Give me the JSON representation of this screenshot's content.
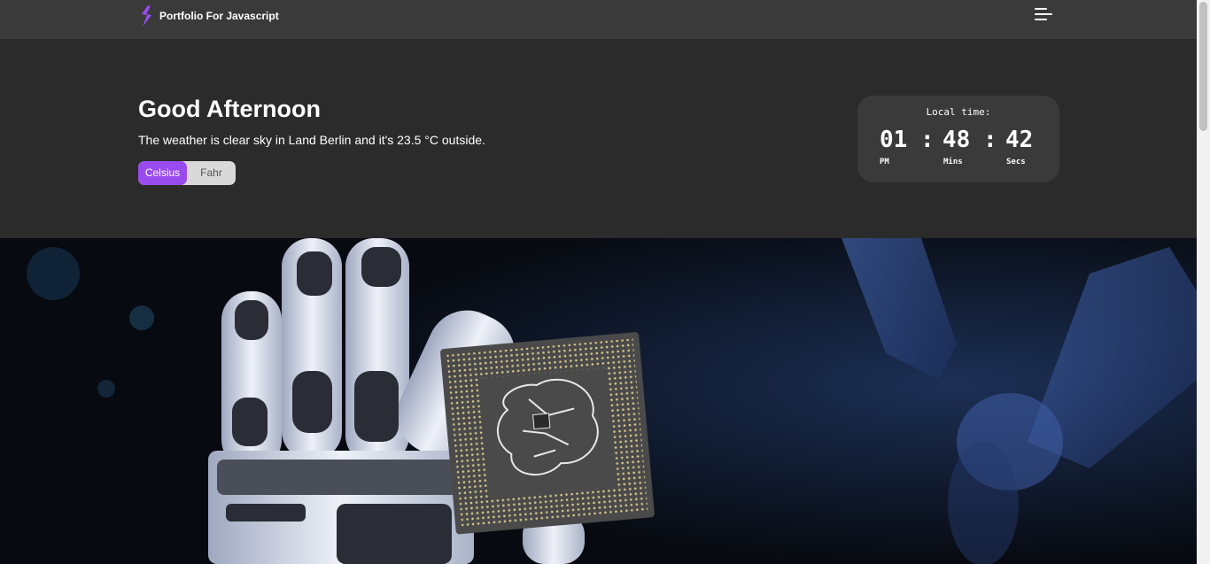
{
  "brand": {
    "name": "Portfolio For Javascript",
    "icon": "lightning-bolt-icon",
    "accent": "#9a4bf0"
  },
  "nav": {
    "menu_icon": "hamburger-menu-icon"
  },
  "hero": {
    "greeting": "Good Afternoon",
    "weather_text": "The weather is clear sky in Land Berlin and it's 23.5 °C outside.",
    "unit_toggle": {
      "options": [
        "Celsius",
        "Fahr"
      ],
      "selected": "Celsius"
    }
  },
  "clock": {
    "title": "Local time:",
    "hours": "01",
    "minutes": "48",
    "seconds": "42",
    "separator": ":",
    "labels": {
      "period": "PM",
      "minutes": "Mins",
      "seconds": "Secs"
    }
  },
  "banner": {
    "image": "robotic hand holding a microchip"
  }
}
